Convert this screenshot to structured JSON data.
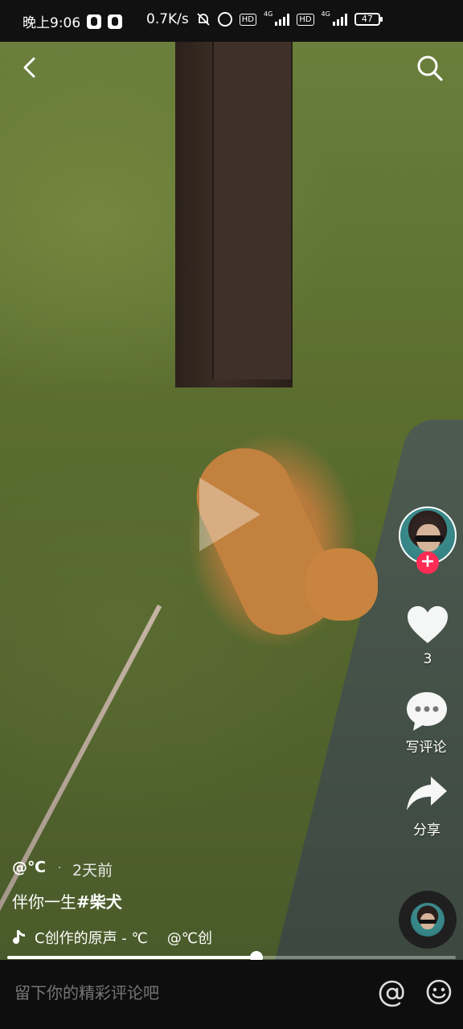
{
  "status_bar": {
    "time": "晚上9:06",
    "speed": "0.7K/s",
    "network": "4G",
    "battery": "47"
  },
  "video": {
    "progress": 0.555
  },
  "sidebar": {
    "like_count": "3",
    "comment_label": "写评论",
    "share_label": "分享"
  },
  "info": {
    "author": "@℃",
    "time_ago": "2天前",
    "caption_text": "伴你一生",
    "caption_tag": "#柴犬",
    "music_text": "C创作的原声 - ℃",
    "music_author": "@℃创"
  },
  "comment_bar": {
    "placeholder": "留下你的精彩评论吧"
  },
  "colors": {
    "follow_accent": "#fe2c55",
    "background": "#000000"
  },
  "icons": [
    "back-icon",
    "search-icon",
    "heart-icon",
    "comment-icon",
    "share-icon",
    "music-note-icon",
    "at-icon",
    "emoji-icon"
  ]
}
